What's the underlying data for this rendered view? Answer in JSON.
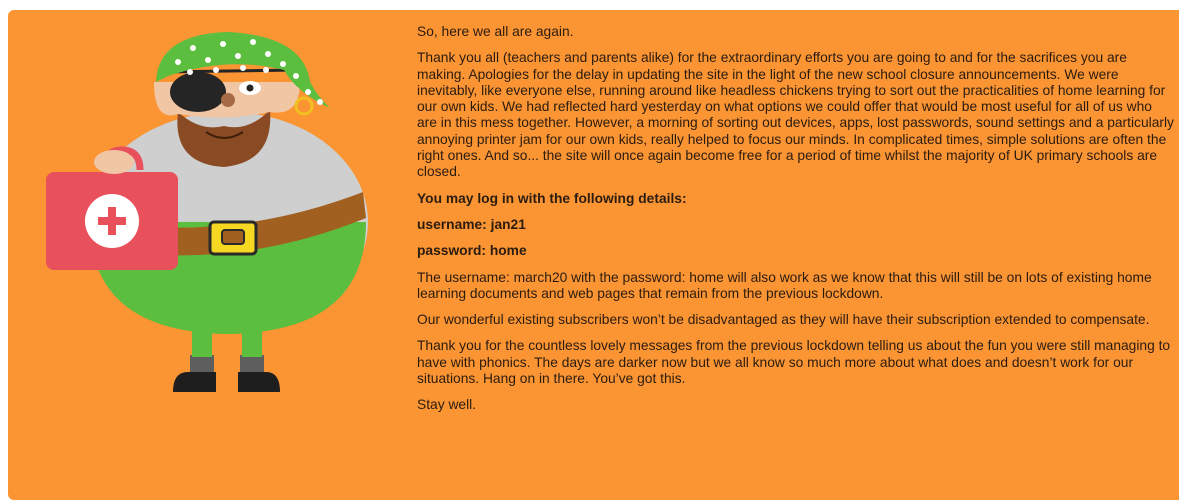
{
  "message": {
    "greeting": "So, here we all are again.",
    "thanks": "Thank you all (teachers and parents alike) for the extraordinary efforts you are going to and for the sacrifices you are making.  Apologies for the delay in updating the site in the light of the new school closure announcements.  We were inevitably, like everyone else, running around like headless chickens trying to sort out the practicalities of home learning for our own kids.  We had reflected hard yesterday on what options we could offer that would be most useful for all of us who are in this mess together.   However, a morning of sorting out devices, apps, lost passwords, sound settings and a particularly annoying printer jam for our own kids, really helped to focus our minds.   In complicated times, simple solutions are often the right ones.  And so... the site will once again become free for a period of time whilst the majority of UK primary schools are closed.",
    "login_intro": "You may log in with the following details:",
    "username_line": "username: jan21",
    "password_line": "password: home",
    "alt_login": "The username: march20 with the password: home will also work as we know that this will still be on lots of existing home learning documents and web pages that remain from the previous lockdown.",
    "subscribers": "Our wonderful existing subscribers won’t be disadvantaged as they will have their subscription extended to compensate.",
    "closing_thanks": "Thank you for the countless lovely messages from the previous lockdown telling us about the fun you were still managing to have with phonics.  The days are darker now but we all know so much more about what does and doesn’t work for our situations.  Hang on in there.  You’ve got this.",
    "signoff": "Stay well."
  },
  "colors": {
    "panel_background": "#fb9433",
    "text": "#2b1c10"
  },
  "illustration": {
    "icon": "pirate-with-first-aid-kit-icon"
  }
}
